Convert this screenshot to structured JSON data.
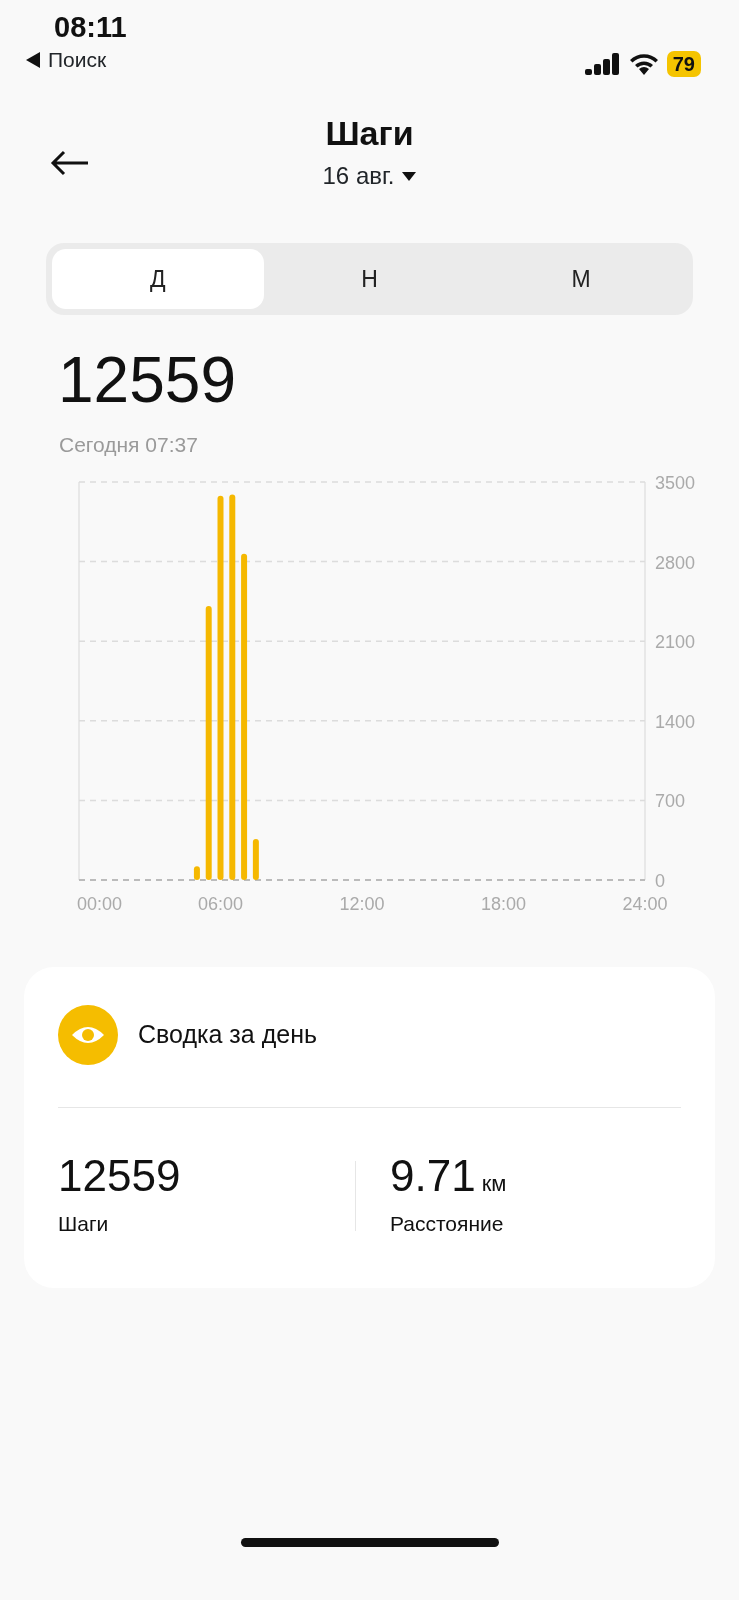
{
  "status_bar": {
    "time": "08:11",
    "back_label": "Поиск",
    "battery": "79"
  },
  "header": {
    "title": "Шаги",
    "date": "16 авг."
  },
  "tabs": [
    {
      "label": "Д",
      "selected": true
    },
    {
      "label": "Н",
      "selected": false
    },
    {
      "label": "М",
      "selected": false
    }
  ],
  "total": {
    "value": "12559",
    "updated": "Сегодня 07:37"
  },
  "chart_data": {
    "type": "bar",
    "x": [
      5,
      5.5,
      6,
      6.5,
      7,
      7.5
    ],
    "values": [
      120,
      2410,
      3380,
      3390,
      2870,
      360
    ],
    "xlim": [
      0,
      24
    ],
    "ylim": [
      0,
      3500
    ],
    "xticks": [
      {
        "value": 0,
        "label": "00:00"
      },
      {
        "value": 6,
        "label": "06:00"
      },
      {
        "value": 12,
        "label": "12:00"
      },
      {
        "value": 18,
        "label": "18:00"
      },
      {
        "value": 24,
        "label": "24:00"
      }
    ],
    "yticks": [
      0,
      700,
      1400,
      2100,
      2800,
      3500
    ],
    "grid": true
  },
  "summary": {
    "title": "Сводка за день",
    "stats": [
      {
        "value": "12559",
        "label": "Шаги"
      },
      {
        "value": "9.71",
        "unit": "км",
        "label": "Расстояние"
      }
    ]
  }
}
